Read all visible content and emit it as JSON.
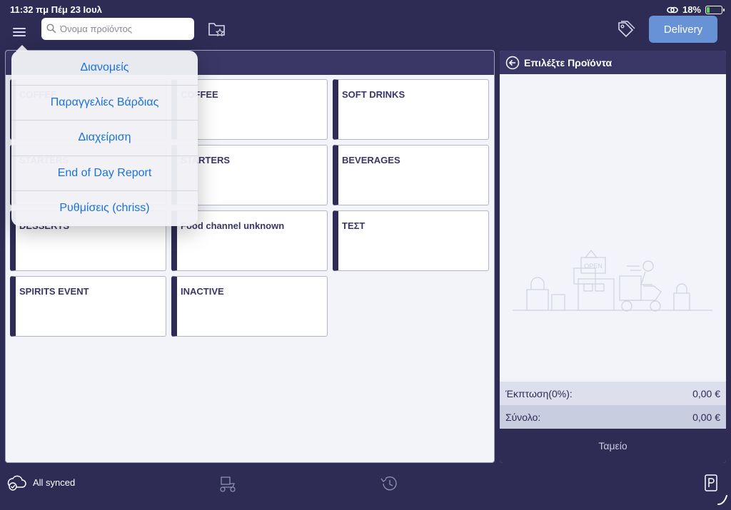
{
  "status_bar": {
    "time": "11:32 πμ   Πέμ 23 Ιουλ",
    "battery": "18%",
    "battery_level": 0.18
  },
  "topbar": {
    "menu_icon": "hamburger-icon",
    "search_placeholder": "Όνομα προϊόντος",
    "favorites_icon": "folder-star-icon",
    "tag_icon": "tag-icon",
    "delivery_label": "Delivery"
  },
  "menu": {
    "items": [
      {
        "label": "Διανομείς"
      },
      {
        "label": "Παραγγελίες Βάρδιας"
      },
      {
        "label": "Διαχείριση"
      },
      {
        "label": "End of Day Report"
      },
      {
        "label": "Ρυθμίσεις (chriss)"
      }
    ]
  },
  "categories": [
    {
      "label": "COFFEE",
      "visible_label": "FFEE"
    },
    {
      "label": "SOFT DRINKS"
    },
    {
      "label": "STARTERS",
      "visible_label": "ERS"
    },
    {
      "label": "BEVERAGES"
    },
    {
      "label": "DESSERTS",
      "visible_label": "DESSERTS"
    },
    {
      "label": "Food channel unknown"
    },
    {
      "label": "ΤΕΣΤ"
    },
    {
      "label": "SPIRITS EVENT"
    },
    {
      "label": "INACTIVE"
    }
  ],
  "cart": {
    "title": "Επιλέξτε Προϊόντα",
    "discount_label": "Έκπτωση(0%):",
    "discount_value": "0,00 €",
    "total_label": "Σύνολο:",
    "total_value": "0,00 €",
    "checkout_label": "Ταμείο",
    "illustration_sign": "OPEN"
  },
  "bottombar": {
    "sync_label": "All synced",
    "colors": {
      "accent": "#6792d6",
      "header": "#3a3766",
      "dark": "#2e2b54",
      "link": "#1a73d9"
    }
  }
}
